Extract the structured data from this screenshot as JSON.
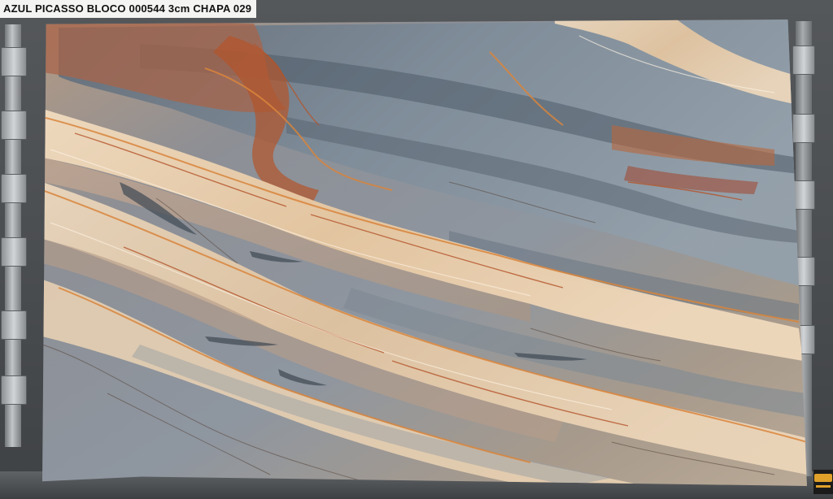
{
  "caption": {
    "text": "AZUL PICASSO BLOCO 000544 3cm CHAPA 029"
  },
  "colors": {
    "slate_blue": "#7e8c98",
    "dark_slate": "#4c5864",
    "cream": "#e9d2b2",
    "rust": "#b4542a",
    "orange_vein": "#d9853c",
    "background": "#4b4e51"
  },
  "icons": {
    "logo": "stone-dealer-logo"
  }
}
